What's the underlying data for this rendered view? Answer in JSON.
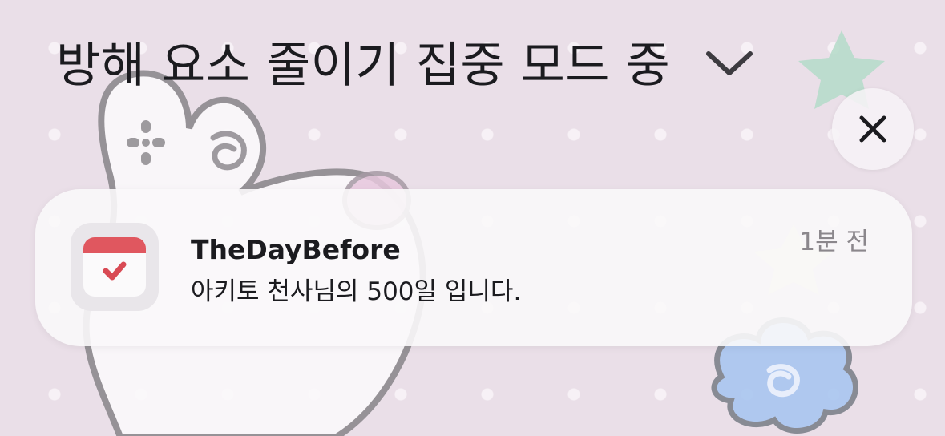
{
  "focus": {
    "title": "방해 요소 줄이기 집중 모드 중",
    "chevron_icon": "chevron-down-icon"
  },
  "close_button": {
    "icon": "close-icon"
  },
  "notification": {
    "app_name": "TheDayBefore",
    "message": "아키토 천사님의 500일 입니다.",
    "time": "1분 전",
    "app_icon": "calendar-check-icon"
  },
  "colors": {
    "text": "#1b1b1f",
    "secondary_text": "#8b878c",
    "wallpaper_base": "#eadfe8",
    "calendar_red": "#e0575f"
  }
}
